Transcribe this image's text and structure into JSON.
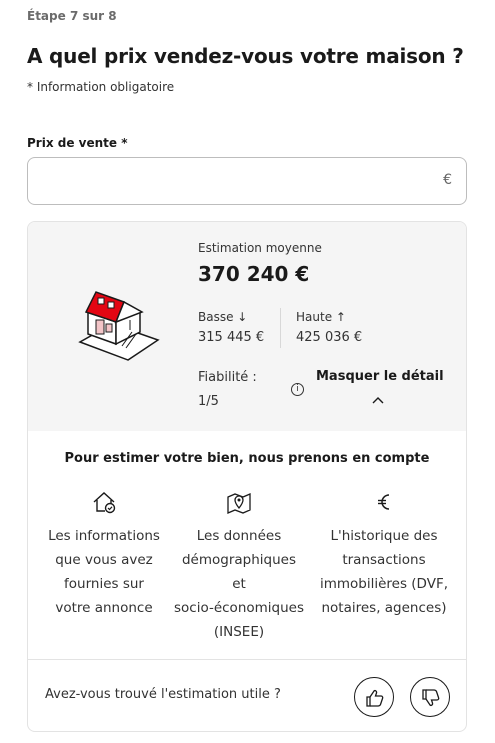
{
  "header": {
    "step": "Étape 7 sur 8",
    "title": "A quel prix vendez-vous votre maison ?",
    "required_note": "*  Information obligatoire"
  },
  "price_field": {
    "label": "Prix de vente *",
    "value": "",
    "currency": "€"
  },
  "estimate": {
    "label": "Estimation moyenne",
    "value": "370 240 €",
    "low_label": "Basse ↓",
    "low_value": "315 445 €",
    "high_label": "Haute ↑",
    "high_value": "425 036 €",
    "reliability_label": "Fiabilité :",
    "reliability_value": "1/5",
    "info_icon": "i",
    "hide_detail": "Masquer le détail",
    "house_icon": "house-illustration-icon",
    "accent_color": "#e30613"
  },
  "factors": {
    "title": "Pour estimer votre bien, nous prenons en compte",
    "items": [
      {
        "icon": "house-check-icon",
        "text_lines": [
          "Les informations",
          "que vous avez",
          "fournies sur",
          "votre annonce"
        ]
      },
      {
        "icon": "map-pin-icon",
        "text_lines": [
          "Les données",
          "démographiques",
          "et",
          "socio-économiques",
          "(INSEE)"
        ]
      },
      {
        "icon": "euro-icon",
        "text_lines": [
          "L'historique des",
          "transactions",
          "immobilières (DVF,",
          "notaires, agences)"
        ]
      }
    ]
  },
  "feedback": {
    "question": "Avez-vous trouvé l'estimation utile ?",
    "up_icon": "thumbs-up-icon",
    "down_icon": "thumbs-down-icon"
  }
}
